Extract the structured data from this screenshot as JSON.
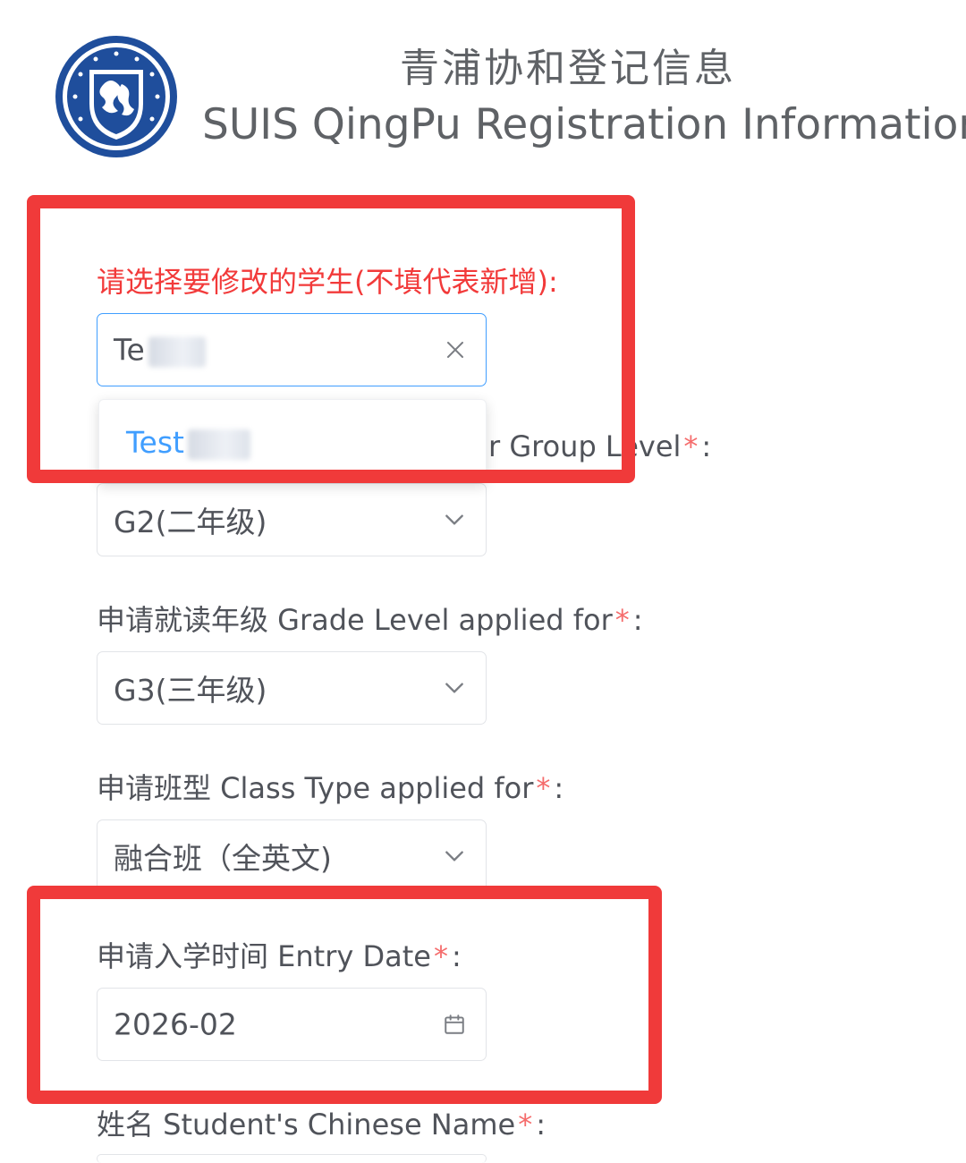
{
  "header": {
    "title_cn": "青浦协和登记信息",
    "title_en": "SUIS QingPu Registration Information"
  },
  "form": {
    "student_select": {
      "label": "请选择要修改的学生(不填代表新增):",
      "value_prefix": "Te",
      "option_prefix": "Test"
    },
    "current_grade": {
      "label_visible": "r Group Level",
      "value": "G2(二年级)"
    },
    "applied_grade": {
      "label": "申请就读年级 Grade Level applied for",
      "value": "G3(三年级)"
    },
    "class_type": {
      "label": "申请班型 Class Type applied for",
      "value": "融合班（全英文)"
    },
    "entry_date": {
      "label": "申请入学时间 Entry Date",
      "value": "2026-02"
    },
    "chinese_name": {
      "label": "姓名 Student's Chinese Name"
    },
    "required_mark": "*",
    "colon": ":"
  },
  "colors": {
    "accent": "#409eff",
    "highlight_box": "#f03a3a",
    "required": "#f56c6c"
  },
  "icons": [
    "school-crest-logo",
    "clear-x-icon",
    "chevron-down-icon",
    "calendar-icon"
  ]
}
